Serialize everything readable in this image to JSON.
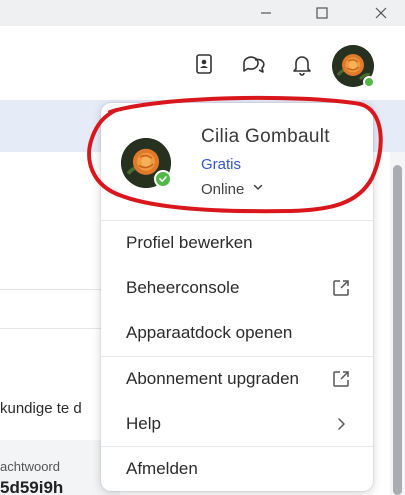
{
  "window": {
    "minimize_icon": "minimize-icon",
    "maximize_icon": "maximize-icon",
    "close_icon": "close-icon"
  },
  "header": {
    "icons": [
      "contacts-icon",
      "chat-icon",
      "bell-icon"
    ],
    "avatar_status": "online"
  },
  "background": {
    "text_fragment": "kundige te d",
    "field_label": "achtwoord",
    "field_value": "5d59i9h"
  },
  "profile": {
    "name": "Cilia Gombault",
    "plan": "Gratis",
    "status": "Online",
    "status_icon": "chevron-down-icon"
  },
  "menu": {
    "items": [
      {
        "label": "Profiel bewerken",
        "icon": ""
      },
      {
        "label": "Beheerconsole",
        "icon": "external-link-icon"
      },
      {
        "label": "Apparaatdock openen",
        "icon": ""
      },
      {
        "label": "Abonnement upgraden",
        "icon": "external-link-icon"
      },
      {
        "label": "Help",
        "icon": "chevron-right-icon"
      },
      {
        "label": "Afmelden",
        "icon": ""
      }
    ]
  },
  "colors": {
    "accent_blue": "#3355cc",
    "presence_green": "#52b848",
    "annotation_red": "#d9161c"
  }
}
